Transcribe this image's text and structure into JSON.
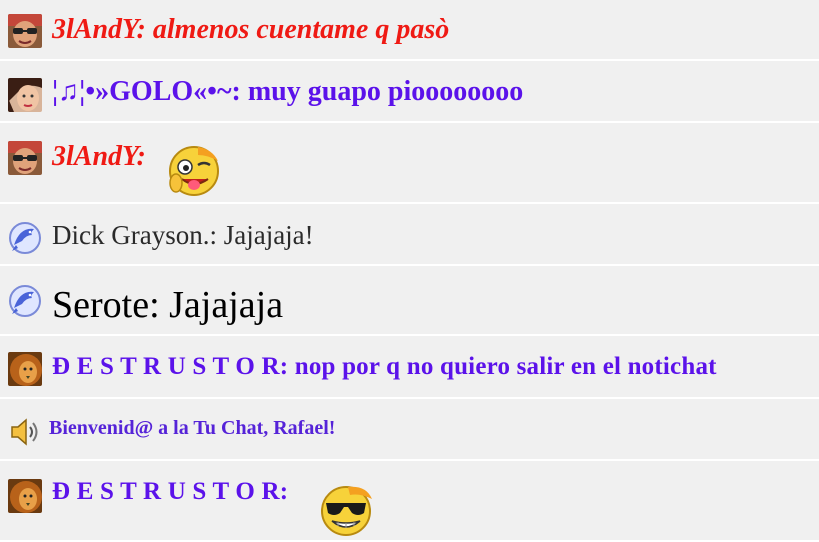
{
  "messages": [
    {
      "nick": "3lAndY:",
      "text": " almenos cuentame q pasò",
      "avatar": "andy-avatar"
    },
    {
      "nick": "¦♫¦•»GOLO«•~:",
      "text": " muy guapo pioooooooo",
      "avatar": "golo-avatar"
    },
    {
      "nick": "3lAndY:",
      "text": "",
      "emoticon": "winking-tongue-emoticon",
      "avatar": "andy-avatar"
    },
    {
      "nick": "Dick Grayson.:",
      "text": " Jajajaja!",
      "avatar": "dolphin-avatar"
    },
    {
      "nick": "Serote:",
      "text": " Jajajaja",
      "avatar": "dolphin-avatar"
    },
    {
      "nick": "Đ E S T R U S T O R:",
      "text": " nop por q no quiero salir en el notichat",
      "avatar": "lion-avatar"
    },
    {
      "nick": "",
      "text": "Bienvenid@ a la Tu Chat, Rafael!",
      "avatar": "speaker-icon"
    },
    {
      "nick": "Đ E S T R U S T O R:",
      "text": "",
      "emoticon": "cool-sunglasses-emoticon",
      "avatar": "lion-avatar"
    }
  ],
  "colors": {
    "row_background": "#f0f0f0",
    "separator": "#ffffff",
    "red_nick": "#ef1a14",
    "purple_nick": "#5b12ea",
    "grey_text": "#2a2a2a"
  }
}
